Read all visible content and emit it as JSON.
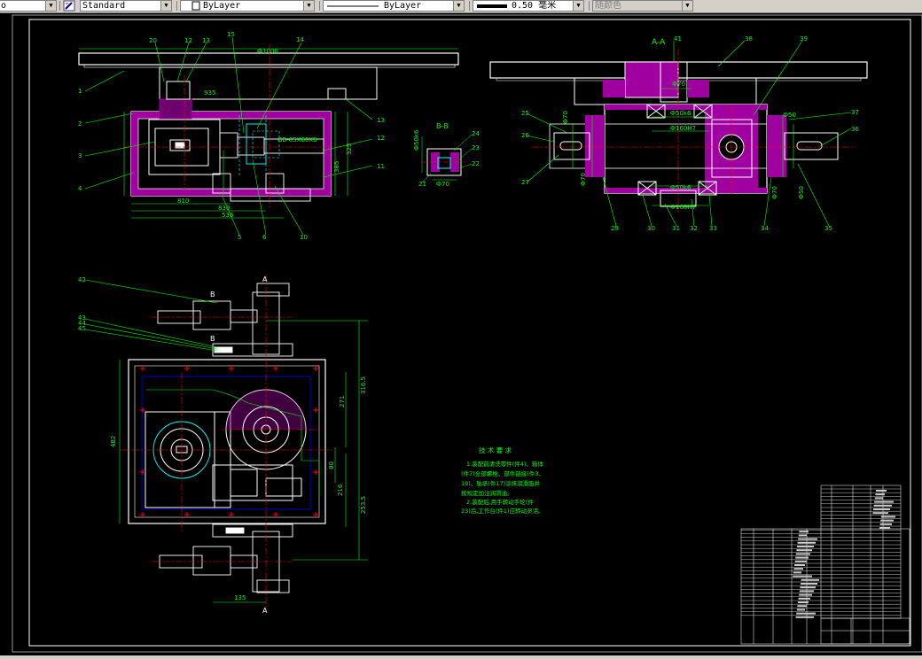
{
  "toolbar": {
    "left_fragment": "o",
    "textstyle": "Standard",
    "layer": "ByLayer",
    "linetype": "ByLayer",
    "lineweight_value": "0.50",
    "lineweight_unit": "毫米",
    "plotstyle": "随颜色"
  },
  "colors": {
    "background": "#000000",
    "frame": "#ffffff",
    "outline": "#ffffff",
    "dimension": "#00ff00",
    "centerline": "#ff0000",
    "hatch": "#ff00ff",
    "hidden": "#00ffff",
    "aux": "#0000ff",
    "yellow": "#ffff00"
  },
  "icons": [
    "textstyle-icon",
    "layer-color-icon",
    "lineweight-icon"
  ],
  "views": {
    "section_aa": "A-A",
    "section_bb": "B-B",
    "plan_cut_a": "A",
    "plan_cut_b": "B"
  },
  "dims": {
    "top_width": "Ф1000",
    "d_935": "935",
    "d_810": "810",
    "d_830": "830",
    "d_536": "536",
    "gb_ref": "GB-85X60X6",
    "d_385": "385",
    "d_325": "325",
    "d_285_top": "Ф70",
    "d_phi50k6": "Ф50k6",
    "d_phi160h7": "Ф160H7",
    "d_phi150k6": "Ф50k6",
    "d_phi160h7b": "Ф160H7",
    "d_phi70": "Ф70",
    "d_phi70b": "Ф70",
    "d_376": "Ф70",
    "d_466": "Ф50",
    "d_phi50": "Ф50",
    "b_phi50k6": "Ф50k6",
    "b_phi70": "Ф70",
    "plan_316": "316.5",
    "plan_271": "271",
    "plan_80": "80",
    "plan_216": "216",
    "plan_253": "253.5",
    "plan_482": "482",
    "plan_135": "135"
  },
  "callouts_front": [
    "1",
    "2",
    "3",
    "4",
    "5",
    "6",
    "7",
    "8",
    "9",
    "10",
    "11",
    "12",
    "13",
    "14",
    "15",
    "16",
    "17",
    "18",
    "19",
    "20"
  ],
  "callouts_section": [
    "22",
    "23",
    "24",
    "25",
    "26",
    "27",
    "28",
    "29",
    "30",
    "31",
    "32",
    "33",
    "34",
    "35",
    "36",
    "37",
    "38",
    "39",
    "40",
    "41"
  ],
  "callouts_plan": [
    "42",
    "43",
    "44",
    "45"
  ],
  "tech_req": {
    "title": "技 术 要 求",
    "line1": "1.装配前清洗零件(件4)、箱体",
    "line2": "(件7)全部螺栓、部件链接(件3、",
    "line3": "19)、轴承(件17)涂抹润滑脂并",
    "line4": "按规定加注润滑油。",
    "line5": "2.装配后,用手转动手轮(件",
    "line6": "23)后,工作台(件1)应转动灵活。"
  }
}
